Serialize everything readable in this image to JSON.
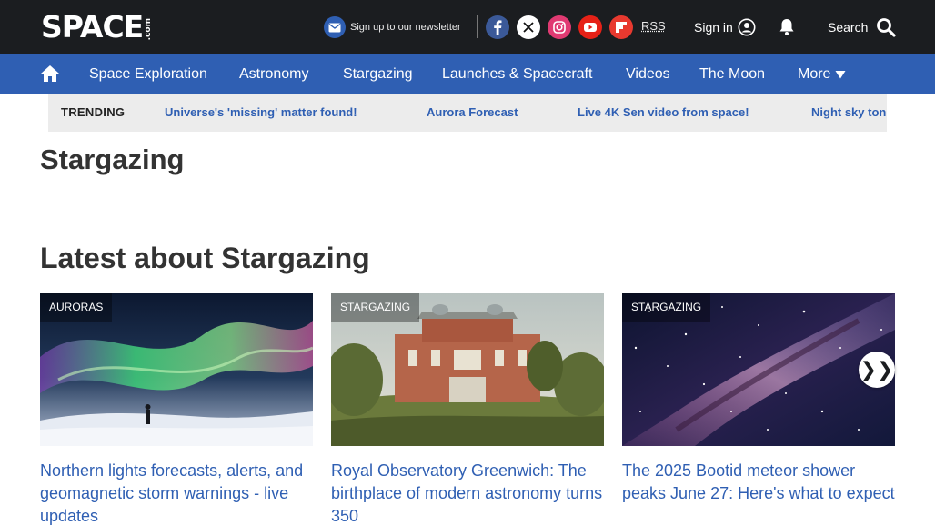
{
  "header": {
    "logo": "SPACE",
    "logo_suffix": ".com",
    "newsletter_label": "Sign up to our newsletter",
    "rss_label": "RSS",
    "signin_label": "Sign in",
    "search_label": "Search",
    "social_icons": [
      "facebook-icon",
      "x-icon",
      "instagram-icon",
      "youtube-icon",
      "flipboard-icon"
    ]
  },
  "nav": {
    "items": [
      "Space Exploration",
      "Astronomy",
      "Stargazing",
      "Launches & Spacecraft",
      "Videos",
      "The Moon"
    ],
    "more_label": "More"
  },
  "trending": {
    "label": "TRENDING",
    "items": [
      "Universe's 'missing' matter found!",
      "Aurora Forecast",
      "Live 4K Sen video from space!",
      "Night sky tonight"
    ]
  },
  "page": {
    "title": "Stargazing",
    "section_title": "Latest about Stargazing"
  },
  "cards": [
    {
      "tag": "AURORAS",
      "title": "Northern lights forecasts, alerts, and geomagnetic storm warnings - live updates"
    },
    {
      "tag": "STARGAZING",
      "title": "Royal Observatory Greenwich: The birthplace of modern astronomy turns 350"
    },
    {
      "tag": "STARGAZING",
      "title": "The 2025 Bootid meteor shower peaks June 27: Here's what to expect"
    }
  ],
  "carousel": {
    "next_symbol": "❯❯"
  },
  "colors": {
    "topbar": "#1b1d20",
    "navbar": "#2f5fb3",
    "link": "#2f5fb3",
    "trending_bg": "#ececec"
  }
}
